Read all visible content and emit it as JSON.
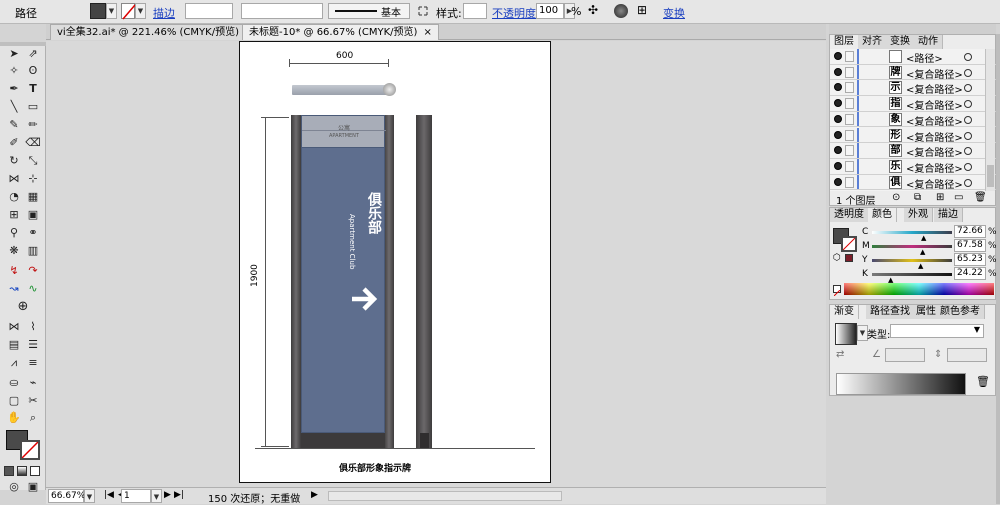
{
  "control_bar": {
    "object_type": "路径",
    "stroke_link": "描边",
    "stroke_style": "基本",
    "style_label": "样式:",
    "opacity_link": "不透明度",
    "opacity_value": "100",
    "opacity_unit": "%",
    "transform_link": "变换"
  },
  "tabs": [
    {
      "label": "vi全集32.ai* @ 221.46% (CMYK/预览)"
    },
    {
      "label": "未标题-10* @ 66.67% (CMYK/预览)"
    }
  ],
  "artboard": {
    "width_dim": "600",
    "height_dim": "1900",
    "sign_top_cn": "公寓",
    "sign_top_en": "APARTMENT",
    "sign_title": "俱乐部",
    "sign_subtitle": "Apartment Club",
    "caption": "俱乐部形象指示牌"
  },
  "status_bar": {
    "zoom": "66.67%",
    "page": "1",
    "history": "150 次还原；无重做"
  },
  "layers_panel": {
    "tabs": [
      "图层",
      "对齐",
      "变换",
      "动作"
    ],
    "rows": [
      {
        "name": "<路径>",
        "char": ""
      },
      {
        "name": "<复合路径>",
        "char": "牌"
      },
      {
        "name": "<复合路径>",
        "char": "示"
      },
      {
        "name": "<复合路径>",
        "char": "指"
      },
      {
        "name": "<复合路径>",
        "char": "象"
      },
      {
        "name": "<复合路径>",
        "char": "形"
      },
      {
        "name": "<复合路径>",
        "char": "部"
      },
      {
        "name": "<复合路径>",
        "char": "乐"
      },
      {
        "name": "<复合路径>",
        "char": "俱"
      }
    ],
    "footer": "1 个图层"
  },
  "color_panel": {
    "tabs": [
      "透明度",
      "颜色",
      "外观",
      "描边"
    ],
    "channels": [
      {
        "label": "C",
        "value": "72.66",
        "color": "#27a8c9"
      },
      {
        "label": "M",
        "value": "67.58",
        "color": "#c02d7e"
      },
      {
        "label": "Y",
        "value": "65.23",
        "color": "#e0c01a"
      },
      {
        "label": "K",
        "value": "24.22",
        "color": "#111111"
      }
    ],
    "unit": "%"
  },
  "gradient_panel": {
    "tabs": [
      "渐变",
      "路径查找",
      "属性",
      "颜色参考"
    ],
    "type_label": "类型:"
  },
  "colors": {
    "panel_blue": "#5e6e8e",
    "post_gray": "#5f5c5e",
    "fill_swatch": "#4a4a4a"
  }
}
